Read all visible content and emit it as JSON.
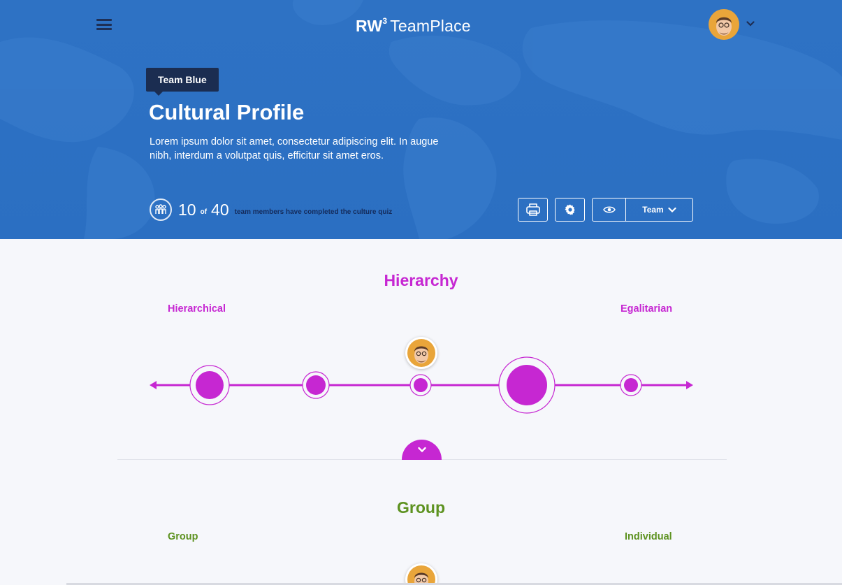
{
  "header": {
    "brand_prefix": "RW",
    "brand_sup": "3",
    "brand_name": "TeamPlace",
    "menu_icon": "hamburger-menu-icon",
    "profile_chevron_icon": "chevron-down-icon"
  },
  "hero": {
    "team_tag": "Team Blue",
    "title": "Cultural Profile",
    "description": "Lorem ipsum dolor sit amet, consectetur adipiscing elit. In augue nibh, interdum a volutpat quis, efficitur sit amet eros.",
    "progress": {
      "completed": "10",
      "of_label": "of",
      "total": "40",
      "message": "team members have completed the culture quiz"
    },
    "view_select": {
      "selected": "Team"
    }
  },
  "sections": [
    {
      "title": "Hierarchy",
      "left_pole": "Hierarchical",
      "right_pole": "Egalitarian",
      "color": "#c627d2"
    },
    {
      "title": "Group",
      "left_pole": "Group",
      "right_pole": "Individual",
      "color": "#5d9220"
    }
  ],
  "colors": {
    "hero_bg": "#2e72c4",
    "tag_bg": "#1b2d51",
    "accent_magenta": "#c627d2",
    "accent_green": "#5d9220",
    "page_bg": "#f6f7fb"
  }
}
